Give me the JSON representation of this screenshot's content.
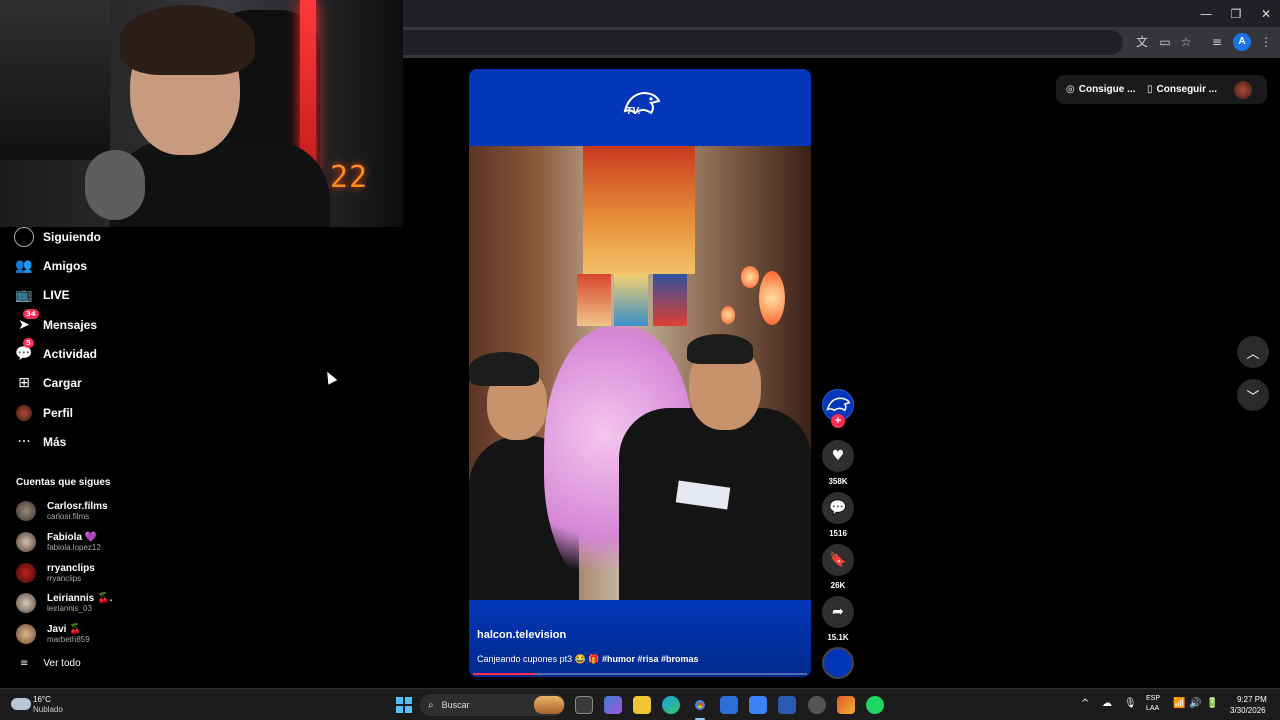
{
  "webcam": {
    "counter": "22"
  },
  "sidebar": {
    "nav": [
      {
        "label": "Siguiendo",
        "icon": "following-icon"
      },
      {
        "label": "Amigos",
        "icon": "friends-icon"
      },
      {
        "label": "LIVE",
        "icon": "live-icon"
      },
      {
        "label": "Mensajes",
        "icon": "messages-icon",
        "badge": "34"
      },
      {
        "label": "Actividad",
        "icon": "activity-icon",
        "badge": "5"
      },
      {
        "label": "Cargar",
        "icon": "upload-icon"
      },
      {
        "label": "Perfil",
        "icon": "profile-icon"
      },
      {
        "label": "Más",
        "icon": "more-icon"
      }
    ],
    "following_title": "Cuentas que sigues",
    "accounts": [
      {
        "name": "Carlosr.films",
        "handle": "carlosr.films"
      },
      {
        "name": "Fabiola",
        "emoji": "💜",
        "handle": "fabiola.lopez12"
      },
      {
        "name": "rryanclips",
        "handle": "rryanclips"
      },
      {
        "name": "Leiriannis",
        "emoji": "🍒.",
        "handle": "leiriannis_03"
      },
      {
        "name": "Javi",
        "emoji": "🍒",
        "handle": "marbeth859"
      }
    ],
    "see_all": "Ver todo"
  },
  "video": {
    "brand_text": "TV.",
    "author": "halcon.television",
    "caption_text": "Canjeando cupones pt3 😂 🎁",
    "hashtags": "#humor #risa #bromas",
    "progress": 0.19
  },
  "actions": {
    "likes": "358K",
    "comments": "1516",
    "saves": "26K",
    "shares": "15.1K"
  },
  "top_right": {
    "item1": "Consigue ...",
    "item2": "Conseguir ..."
  },
  "taskbar": {
    "temp": "16°C",
    "weather": "Nublado",
    "search_placeholder": "Buscar",
    "lang_top": "ESP",
    "lang_bottom": "LAA",
    "time": "9:27 PM",
    "date": "3/30/2026"
  },
  "colors": {
    "accent": "#fe2c55",
    "brand_blue": "#0336b8",
    "windows_blue": "#4cc2ff"
  }
}
